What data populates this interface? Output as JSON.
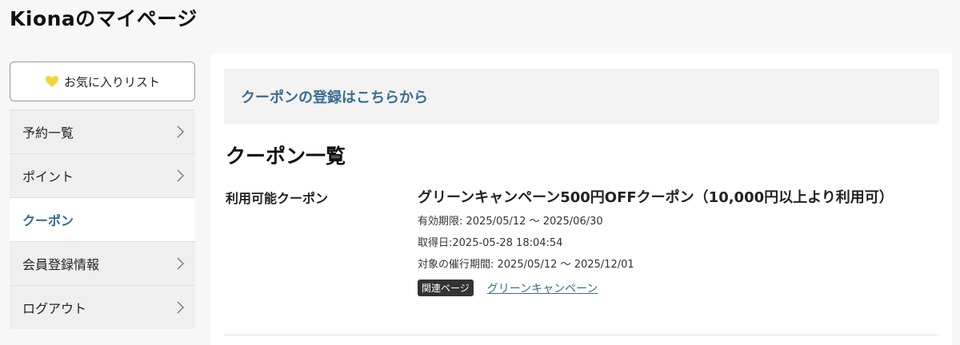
{
  "page": {
    "title": "Kionaのマイページ"
  },
  "sidebar": {
    "favorite_label": "お気に入りリスト",
    "items": [
      {
        "label": "予約一覧",
        "active": false
      },
      {
        "label": "ポイント",
        "active": false
      },
      {
        "label": "クーポン",
        "active": true
      },
      {
        "label": "会員登録情報",
        "active": false
      },
      {
        "label": "ログアウト",
        "active": false
      }
    ]
  },
  "main": {
    "register_link": "クーポンの登録はこちらから",
    "section_title": "クーポン一覧",
    "coupon_label": "利用可能クーポン",
    "coupon": {
      "name": "グリーンキャンペーン500円OFFクーポン（10,000円以上より利用可）",
      "validity": "有効期限: 2025/05/12 〜 2025/06/30",
      "acquired": "取得日:2025-05-28 18:04:54",
      "event_period": "対象の催行期間: 2025/05/12 〜 2025/12/01",
      "related_badge": "関連ページ",
      "related_link": "グリーンキャンペーン"
    }
  },
  "colors": {
    "accent": "#3a6d92",
    "heart": "#f5d33a"
  }
}
